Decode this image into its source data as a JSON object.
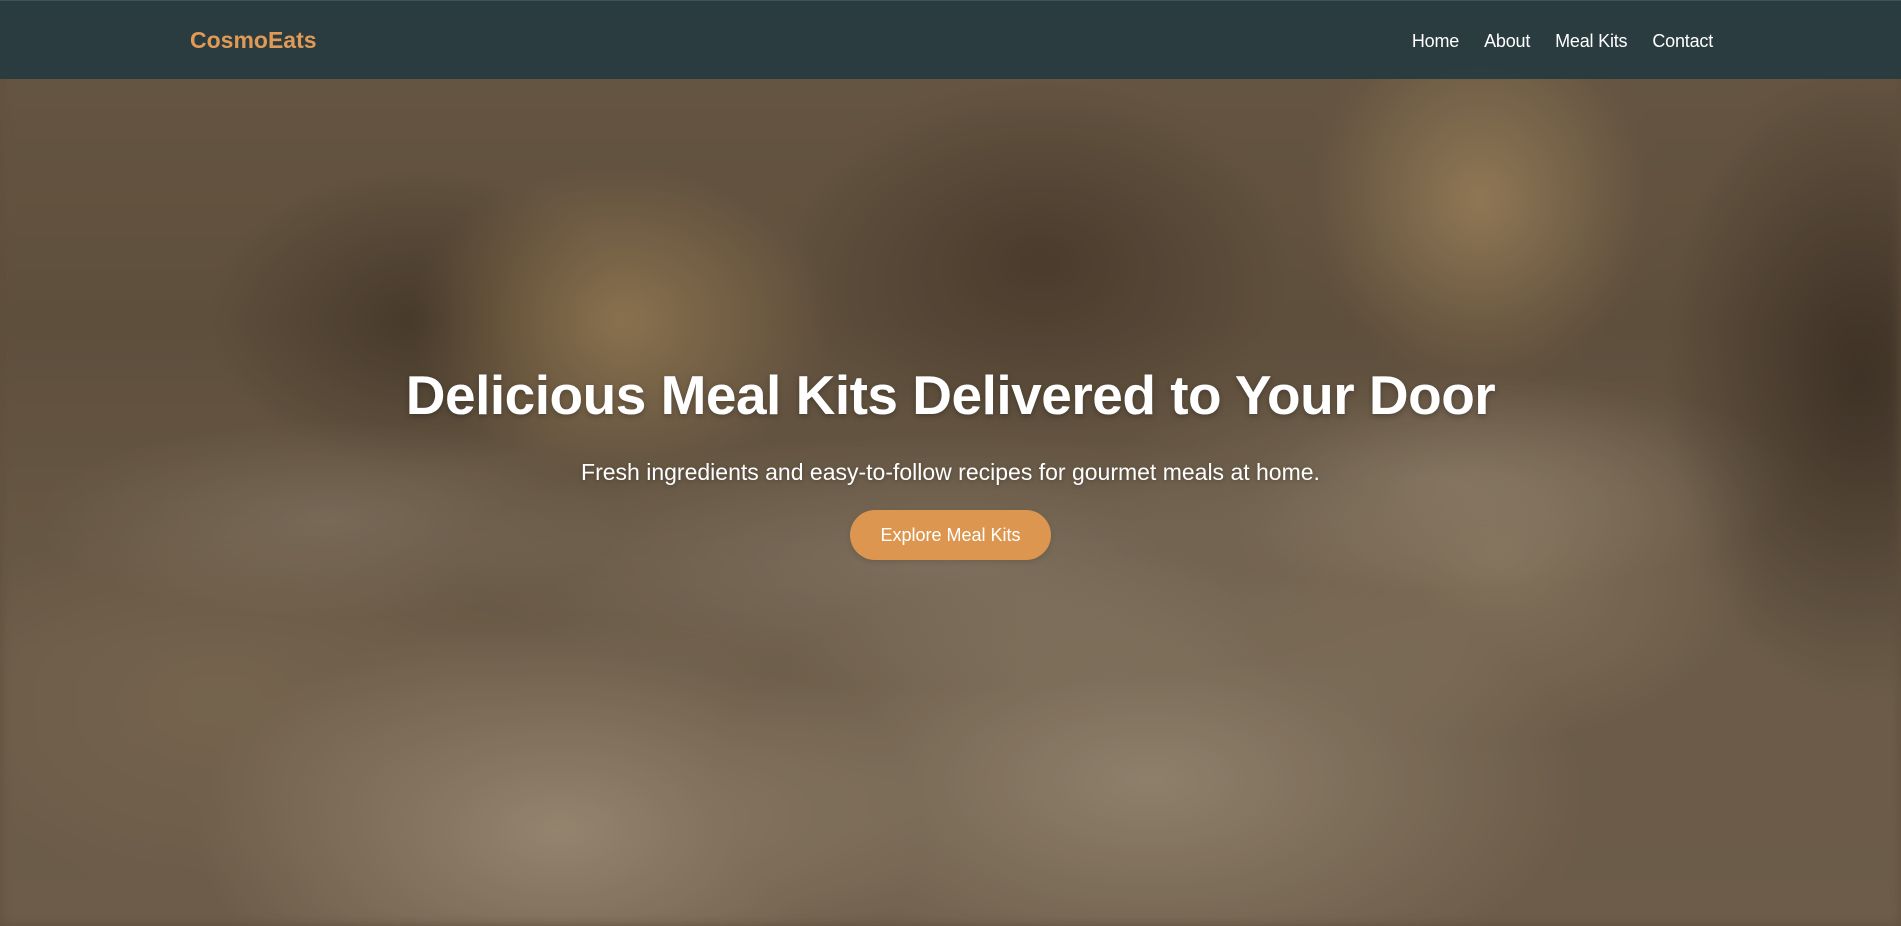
{
  "header": {
    "brand": "CosmoEats",
    "nav": [
      {
        "label": "Home"
      },
      {
        "label": "About"
      },
      {
        "label": "Meal Kits"
      },
      {
        "label": "Contact"
      }
    ]
  },
  "hero": {
    "title": "Delicious Meal Kits Delivered to Your Door",
    "subtitle": "Fresh ingredients and easy-to-follow recipes for gourmet meals at home.",
    "cta_label": "Explore Meal Kits"
  },
  "colors": {
    "brand": "#e09a55",
    "header_bg": "#263a40",
    "cta_bg": "#dd9650",
    "text": "#ffffff"
  }
}
